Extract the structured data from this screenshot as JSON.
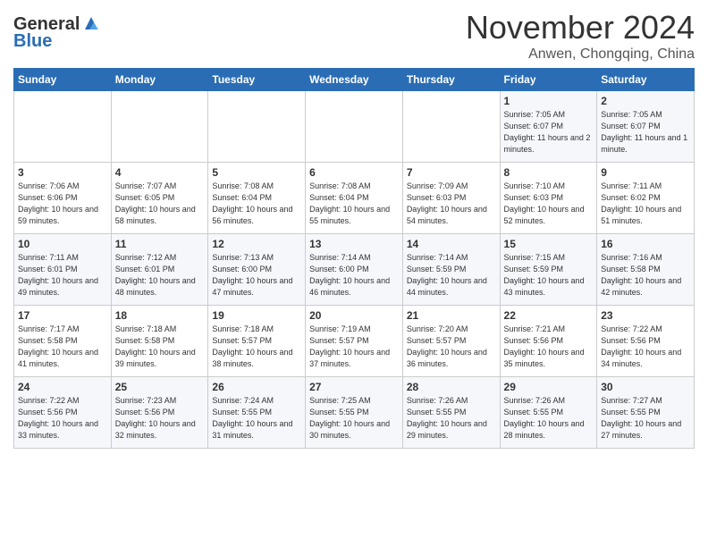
{
  "header": {
    "logo_general": "General",
    "logo_blue": "Blue",
    "month_title": "November 2024",
    "location": "Anwen, Chongqing, China"
  },
  "days_of_week": [
    "Sunday",
    "Monday",
    "Tuesday",
    "Wednesday",
    "Thursday",
    "Friday",
    "Saturday"
  ],
  "weeks": [
    [
      {
        "day": "",
        "info": ""
      },
      {
        "day": "",
        "info": ""
      },
      {
        "day": "",
        "info": ""
      },
      {
        "day": "",
        "info": ""
      },
      {
        "day": "",
        "info": ""
      },
      {
        "day": "1",
        "info": "Sunrise: 7:05 AM\nSunset: 6:07 PM\nDaylight: 11 hours and 2 minutes."
      },
      {
        "day": "2",
        "info": "Sunrise: 7:05 AM\nSunset: 6:07 PM\nDaylight: 11 hours and 1 minute."
      }
    ],
    [
      {
        "day": "3",
        "info": "Sunrise: 7:06 AM\nSunset: 6:06 PM\nDaylight: 10 hours and 59 minutes."
      },
      {
        "day": "4",
        "info": "Sunrise: 7:07 AM\nSunset: 6:05 PM\nDaylight: 10 hours and 58 minutes."
      },
      {
        "day": "5",
        "info": "Sunrise: 7:08 AM\nSunset: 6:04 PM\nDaylight: 10 hours and 56 minutes."
      },
      {
        "day": "6",
        "info": "Sunrise: 7:08 AM\nSunset: 6:04 PM\nDaylight: 10 hours and 55 minutes."
      },
      {
        "day": "7",
        "info": "Sunrise: 7:09 AM\nSunset: 6:03 PM\nDaylight: 10 hours and 54 minutes."
      },
      {
        "day": "8",
        "info": "Sunrise: 7:10 AM\nSunset: 6:03 PM\nDaylight: 10 hours and 52 minutes."
      },
      {
        "day": "9",
        "info": "Sunrise: 7:11 AM\nSunset: 6:02 PM\nDaylight: 10 hours and 51 minutes."
      }
    ],
    [
      {
        "day": "10",
        "info": "Sunrise: 7:11 AM\nSunset: 6:01 PM\nDaylight: 10 hours and 49 minutes."
      },
      {
        "day": "11",
        "info": "Sunrise: 7:12 AM\nSunset: 6:01 PM\nDaylight: 10 hours and 48 minutes."
      },
      {
        "day": "12",
        "info": "Sunrise: 7:13 AM\nSunset: 6:00 PM\nDaylight: 10 hours and 47 minutes."
      },
      {
        "day": "13",
        "info": "Sunrise: 7:14 AM\nSunset: 6:00 PM\nDaylight: 10 hours and 46 minutes."
      },
      {
        "day": "14",
        "info": "Sunrise: 7:14 AM\nSunset: 5:59 PM\nDaylight: 10 hours and 44 minutes."
      },
      {
        "day": "15",
        "info": "Sunrise: 7:15 AM\nSunset: 5:59 PM\nDaylight: 10 hours and 43 minutes."
      },
      {
        "day": "16",
        "info": "Sunrise: 7:16 AM\nSunset: 5:58 PM\nDaylight: 10 hours and 42 minutes."
      }
    ],
    [
      {
        "day": "17",
        "info": "Sunrise: 7:17 AM\nSunset: 5:58 PM\nDaylight: 10 hours and 41 minutes."
      },
      {
        "day": "18",
        "info": "Sunrise: 7:18 AM\nSunset: 5:58 PM\nDaylight: 10 hours and 39 minutes."
      },
      {
        "day": "19",
        "info": "Sunrise: 7:18 AM\nSunset: 5:57 PM\nDaylight: 10 hours and 38 minutes."
      },
      {
        "day": "20",
        "info": "Sunrise: 7:19 AM\nSunset: 5:57 PM\nDaylight: 10 hours and 37 minutes."
      },
      {
        "day": "21",
        "info": "Sunrise: 7:20 AM\nSunset: 5:57 PM\nDaylight: 10 hours and 36 minutes."
      },
      {
        "day": "22",
        "info": "Sunrise: 7:21 AM\nSunset: 5:56 PM\nDaylight: 10 hours and 35 minutes."
      },
      {
        "day": "23",
        "info": "Sunrise: 7:22 AM\nSunset: 5:56 PM\nDaylight: 10 hours and 34 minutes."
      }
    ],
    [
      {
        "day": "24",
        "info": "Sunrise: 7:22 AM\nSunset: 5:56 PM\nDaylight: 10 hours and 33 minutes."
      },
      {
        "day": "25",
        "info": "Sunrise: 7:23 AM\nSunset: 5:56 PM\nDaylight: 10 hours and 32 minutes."
      },
      {
        "day": "26",
        "info": "Sunrise: 7:24 AM\nSunset: 5:55 PM\nDaylight: 10 hours and 31 minutes."
      },
      {
        "day": "27",
        "info": "Sunrise: 7:25 AM\nSunset: 5:55 PM\nDaylight: 10 hours and 30 minutes."
      },
      {
        "day": "28",
        "info": "Sunrise: 7:26 AM\nSunset: 5:55 PM\nDaylight: 10 hours and 29 minutes."
      },
      {
        "day": "29",
        "info": "Sunrise: 7:26 AM\nSunset: 5:55 PM\nDaylight: 10 hours and 28 minutes."
      },
      {
        "day": "30",
        "info": "Sunrise: 7:27 AM\nSunset: 5:55 PM\nDaylight: 10 hours and 27 minutes."
      }
    ]
  ]
}
